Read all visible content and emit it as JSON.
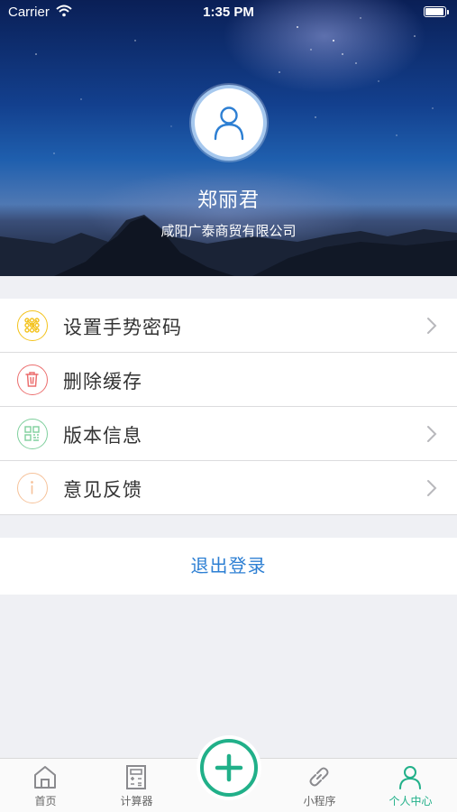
{
  "status_bar": {
    "carrier": "Carrier",
    "time": "1:35 PM",
    "battery_level": 1.0
  },
  "profile": {
    "name": "郑丽君",
    "company": "咸阳广泰商贸有限公司",
    "avatar_icon": "user-icon"
  },
  "menu": {
    "items": [
      {
        "label": "设置手势密码",
        "icon": "gesture-grid-icon",
        "color": "#f3c21b",
        "chevron": true
      },
      {
        "label": "删除缓存",
        "icon": "trash-icon",
        "color": "#ec6f6f",
        "chevron": false
      },
      {
        "label": "版本信息",
        "icon": "qrcode-icon",
        "color": "#7fcf9d",
        "chevron": true
      },
      {
        "label": "意见反馈",
        "icon": "info-icon",
        "color": "#f6c29a",
        "chevron": true
      }
    ]
  },
  "logout": {
    "label": "退出登录",
    "color": "#2d7fd3"
  },
  "tabbar": {
    "accent": "#21b089",
    "tabs": [
      {
        "label": "首页",
        "icon": "home-icon"
      },
      {
        "label": "计算器",
        "icon": "calculator-icon"
      },
      {
        "label": "",
        "icon": "plus-icon"
      },
      {
        "label": "小程序",
        "icon": "link-icon"
      },
      {
        "label": "个人中心",
        "icon": "user-icon"
      }
    ],
    "active": "个人中心"
  }
}
